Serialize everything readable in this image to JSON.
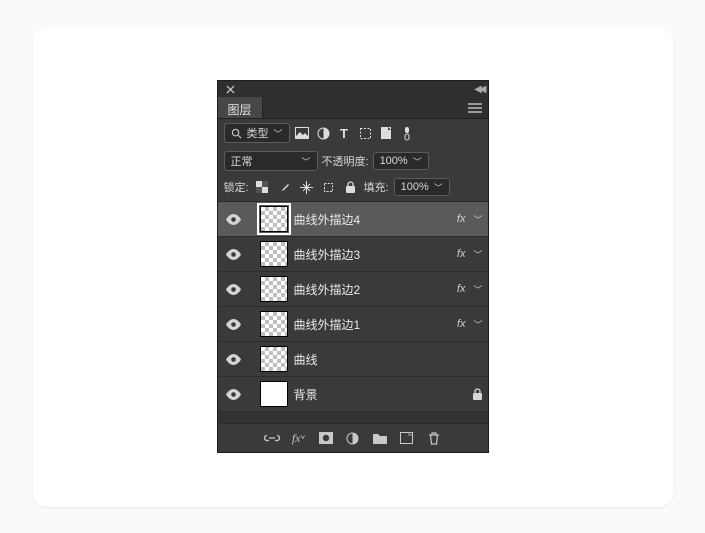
{
  "panel": {
    "title": "图层"
  },
  "filter": {
    "kind": "类型",
    "icons": [
      "image-icon",
      "adjust-icon",
      "text-icon",
      "shape-icon",
      "smart-icon",
      "toggle-icon"
    ]
  },
  "blend": {
    "mode": "正常",
    "opacity_label": "不透明度:",
    "opacity_value": "100%"
  },
  "locks": {
    "label": "锁定:",
    "fill_label": "填充:",
    "fill_value": "100%"
  },
  "layers": [
    {
      "name": "曲线外描边4",
      "visible": true,
      "checker": true,
      "selected": true,
      "fx": true,
      "locked": false
    },
    {
      "name": "曲线外描边3",
      "visible": true,
      "checker": true,
      "selected": false,
      "fx": true,
      "locked": false
    },
    {
      "name": "曲线外描边2",
      "visible": true,
      "checker": true,
      "selected": false,
      "fx": true,
      "locked": false
    },
    {
      "name": "曲线外描边1",
      "visible": true,
      "checker": true,
      "selected": false,
      "fx": true,
      "locked": false
    },
    {
      "name": "曲线",
      "visible": true,
      "checker": true,
      "selected": false,
      "fx": false,
      "locked": false
    },
    {
      "name": "背景",
      "visible": true,
      "checker": false,
      "selected": false,
      "fx": false,
      "locked": true
    }
  ]
}
